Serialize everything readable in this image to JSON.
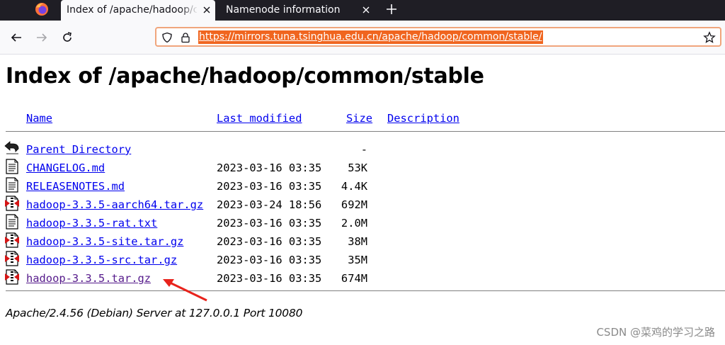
{
  "browser": {
    "tabs": [
      {
        "label": "Index of /apache/hadoop/common/stable",
        "active": true
      },
      {
        "label": "Namenode information",
        "active": false
      }
    ],
    "url": "https://mirrors.tuna.tsinghua.edu.cn/apache/hadoop/common/stable/"
  },
  "page": {
    "title": "Index of /apache/hadoop/common/stable",
    "columns": {
      "name": "Name",
      "last_modified": "Last modified",
      "size": "Size",
      "description": "Description"
    },
    "entries": [
      {
        "icon": "back-icon",
        "name": "Parent Directory",
        "modified": "",
        "size": "-"
      },
      {
        "icon": "text-file-icon",
        "name": "CHANGELOG.md",
        "modified": "2023-03-16 03:35",
        "size": "53K"
      },
      {
        "icon": "text-file-icon",
        "name": "RELEASENOTES.md",
        "modified": "2023-03-16 03:35",
        "size": "4.4K"
      },
      {
        "icon": "compressed-file-icon",
        "name": "hadoop-3.3.5-aarch64.tar.gz",
        "modified": "2023-03-24 18:56",
        "size": "692M"
      },
      {
        "icon": "text-file-icon",
        "name": "hadoop-3.3.5-rat.txt",
        "modified": "2023-03-16 03:35",
        "size": "2.0M"
      },
      {
        "icon": "compressed-file-icon",
        "name": "hadoop-3.3.5-site.tar.gz",
        "modified": "2023-03-16 03:35",
        "size": "38M"
      },
      {
        "icon": "compressed-file-icon",
        "name": "hadoop-3.3.5-src.tar.gz",
        "modified": "2023-03-16 03:35",
        "size": "35M"
      },
      {
        "icon": "compressed-file-icon",
        "name": "hadoop-3.3.5.tar.gz",
        "modified": "2023-03-16 03:35",
        "size": "674M",
        "visited": true
      }
    ],
    "footer": "Apache/2.4.56 (Debian) Server at 127.0.0.1 Port 10080"
  },
  "watermark": "CSDN @菜鸡的学习之路",
  "colors": {
    "link": "#0000ee",
    "visited_link": "#551a8b",
    "url_highlight": "#f0651f",
    "annotation_arrow": "#e8231c"
  }
}
